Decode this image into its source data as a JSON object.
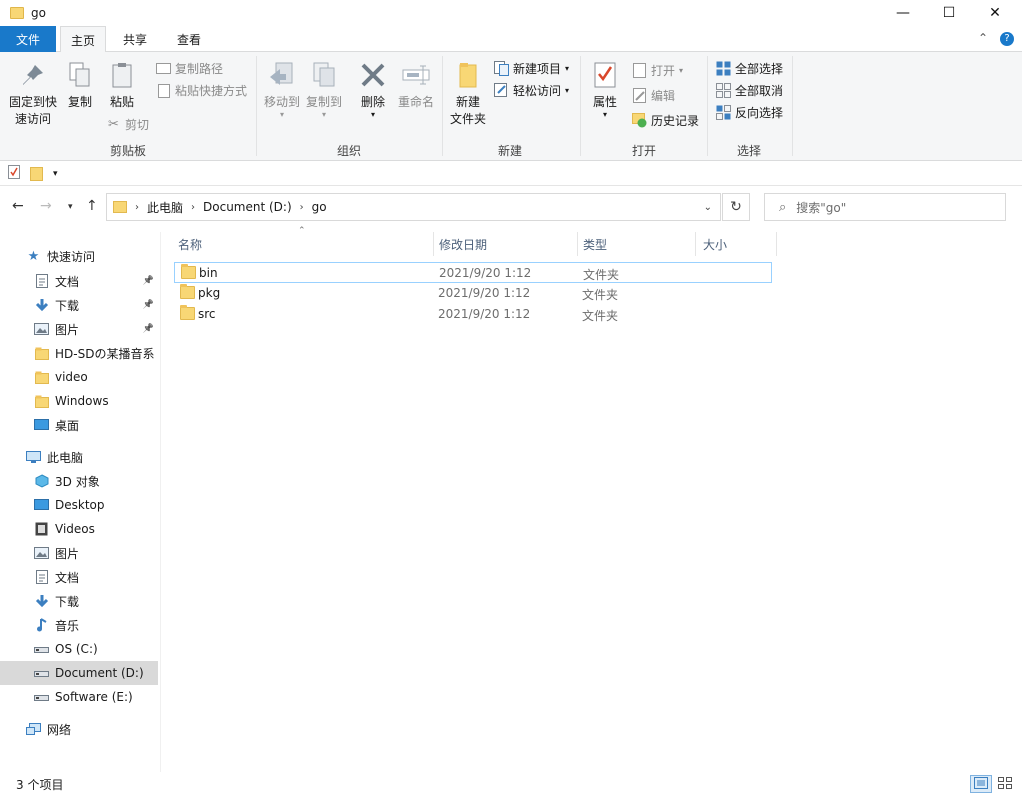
{
  "window": {
    "title": "go",
    "minimize": "—",
    "maximize": "☐",
    "close": "✕"
  },
  "tabs": {
    "file": "文件",
    "home": "主页",
    "share": "共享",
    "view": "查看",
    "collapse": "⌃",
    "help": "?"
  },
  "ribbon": {
    "clipboard": {
      "label": "剪贴板",
      "pin_line1": "固定到快",
      "pin_line2": "速访问",
      "copy": "复制",
      "paste": "粘贴",
      "copy_path": "复制路径",
      "paste_shortcut": "粘贴快捷方式",
      "cut": "剪切"
    },
    "organize": {
      "label": "组织",
      "move_to": "移动到",
      "copy_to": "复制到",
      "delete": "删除",
      "rename": "重命名"
    },
    "new": {
      "label": "新建",
      "new_folder_line1": "新建",
      "new_folder_line2": "文件夹",
      "new_item": "新建项目",
      "easy_access": "轻松访问"
    },
    "open": {
      "label": "打开",
      "properties": "属性",
      "open": "打开",
      "edit": "编辑",
      "history": "历史记录"
    },
    "select": {
      "label": "选择",
      "select_all": "全部选择",
      "select_none": "全部取消",
      "invert": "反向选择"
    }
  },
  "address": {
    "crumbs": [
      "此电脑",
      "Document (D:)",
      "go"
    ],
    "search_placeholder": "搜索\"go\""
  },
  "nav": {
    "quick_access": "快速访问",
    "quick_items": [
      {
        "label": "文档",
        "icon": "document-icon",
        "pinned": true
      },
      {
        "label": "下载",
        "icon": "download-icon",
        "pinned": true
      },
      {
        "label": "图片",
        "icon": "picture-icon",
        "pinned": true
      },
      {
        "label": "HD-SDの某播音系",
        "icon": "folder-icon",
        "pinned": false
      },
      {
        "label": "video",
        "icon": "folder-icon",
        "pinned": false
      },
      {
        "label": "Windows",
        "icon": "folder-icon",
        "pinned": false
      },
      {
        "label": "桌面",
        "icon": "desktop-icon",
        "pinned": false
      }
    ],
    "this_pc": "此电脑",
    "pc_items": [
      {
        "label": "3D 对象",
        "icon": "3d-objects-icon"
      },
      {
        "label": "Desktop",
        "icon": "desktop-icon"
      },
      {
        "label": "Videos",
        "icon": "videos-icon"
      },
      {
        "label": "图片",
        "icon": "picture-icon"
      },
      {
        "label": "文档",
        "icon": "document-icon"
      },
      {
        "label": "下载",
        "icon": "download-icon"
      },
      {
        "label": "音乐",
        "icon": "music-icon"
      },
      {
        "label": "OS (C:)",
        "icon": "drive-icon"
      },
      {
        "label": "Document (D:)",
        "icon": "drive-icon",
        "selected": true
      },
      {
        "label": "Software (E:)",
        "icon": "drive-icon"
      }
    ],
    "network": "网络"
  },
  "columns": {
    "name": "名称",
    "modified": "修改日期",
    "type": "类型",
    "size": "大小"
  },
  "files": [
    {
      "name": "bin",
      "modified": "2021/9/20 1:12",
      "type": "文件夹",
      "size": ""
    },
    {
      "name": "pkg",
      "modified": "2021/9/20 1:12",
      "type": "文件夹",
      "size": ""
    },
    {
      "name": "src",
      "modified": "2021/9/20 1:12",
      "type": "文件夹",
      "size": ""
    }
  ],
  "status": {
    "count": "3 个项目"
  },
  "colors": {
    "accent": "#1979ca",
    "folder": "#f8d775",
    "ribbon_bg": "#f5f6f7",
    "selected_nav": "#d9d9d9",
    "focus_border": "#99d1ff"
  }
}
